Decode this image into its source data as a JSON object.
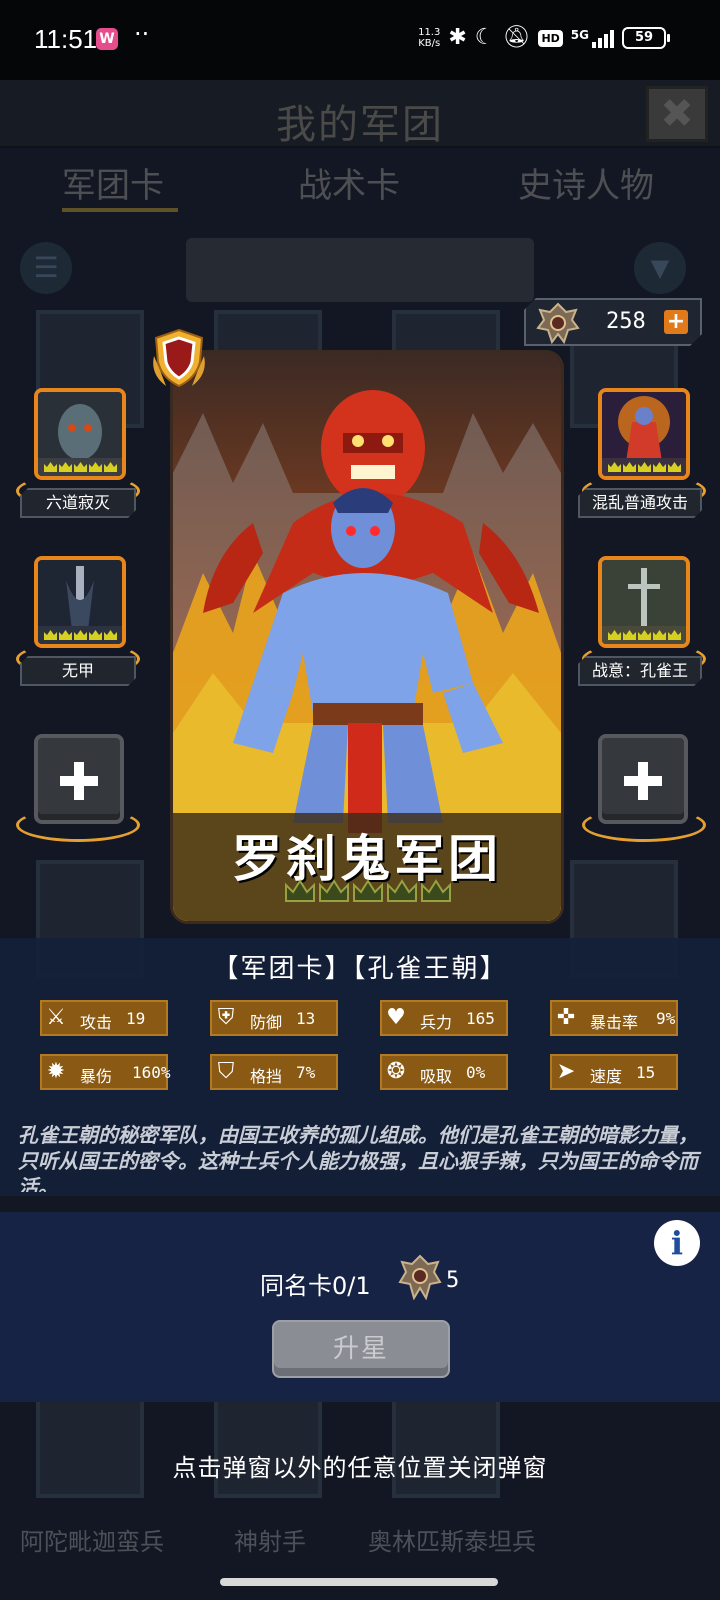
{
  "status_bar": {
    "time": "11:51",
    "app_icon_text": "W",
    "dots": "··",
    "net_speed_value": "11.3",
    "net_speed_unit": "KB/s",
    "hd_badge": "HD",
    "network": "5G",
    "battery": "59"
  },
  "background": {
    "title": "我的军团",
    "tabs": [
      "军团卡",
      "战术卡",
      "史诗人物"
    ],
    "list_names": [
      "阿陀毗迦蛮兵",
      "神射手",
      "奥林匹斯泰坦兵"
    ]
  },
  "currency": {
    "value": "258",
    "plus": "+"
  },
  "card": {
    "name": "罗刹鬼军团",
    "stars": 5
  },
  "skills_left": [
    {
      "label": "六道寂灭"
    },
    {
      "label": "无甲"
    }
  ],
  "skills_right": [
    {
      "label": "混乱普通攻击"
    },
    {
      "label": "战意：孔雀王"
    }
  ],
  "faction_title": "【军团卡】【孔雀王朝】",
  "stats": [
    {
      "icon": "sword-icon",
      "label": "攻击",
      "value": "19"
    },
    {
      "icon": "shield-icon",
      "label": "防御",
      "value": "13"
    },
    {
      "icon": "heart-icon",
      "label": "兵力",
      "value": "165"
    },
    {
      "icon": "crosshair-icon",
      "label": "暴击率",
      "value": "9%"
    },
    {
      "icon": "burst-icon",
      "label": "暴伤",
      "value": "160%"
    },
    {
      "icon": "parry-icon",
      "label": "格挡",
      "value": "7%"
    },
    {
      "icon": "drain-icon",
      "label": "吸取",
      "value": "0%"
    },
    {
      "icon": "boot-icon",
      "label": "速度",
      "value": "15"
    }
  ],
  "description": "孔雀王朝的秘密军队，由国王收养的孤儿组成。他们是孔雀王朝的暗影力量，只听从国王的密令。这种士兵个人能力极强，且心狠手辣，只为国王的命令而活。",
  "upgrade": {
    "same_card_label": "同名卡0/1",
    "cost": "5",
    "button": "升星",
    "info": "i"
  },
  "close_hint": "点击弹窗以外的任意位置关闭弹窗"
}
